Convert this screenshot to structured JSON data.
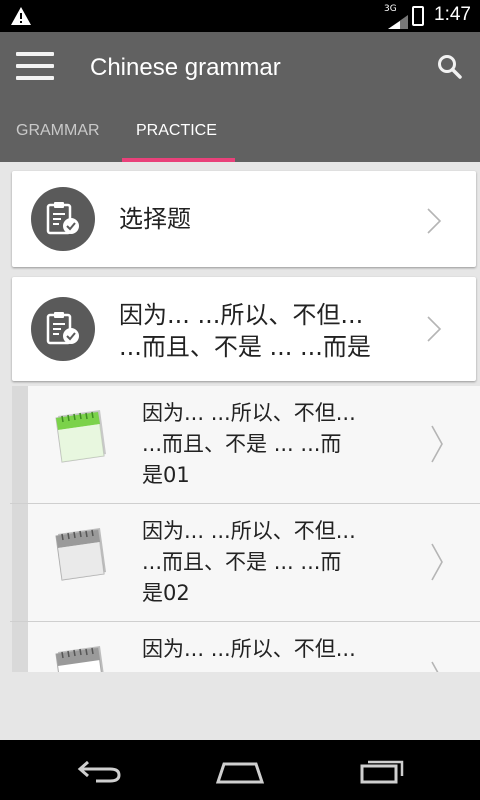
{
  "status_bar": {
    "network": "3G",
    "time": "1:47"
  },
  "app_bar": {
    "title": "Chinese grammar"
  },
  "tabs": [
    {
      "label": "GRAMMAR",
      "selected": false
    },
    {
      "label": "PRACTICE",
      "selected": true
    }
  ],
  "colors": {
    "app_bar": "#616161",
    "tab_indicator": "#e9417a",
    "status_bar": "#000000"
  },
  "cards": [
    {
      "label": "选择题",
      "icon": "clipboard-check-icon"
    },
    {
      "label_line1": "因为... ...所以、不但...",
      "label_line2": "...而且、不是 ... ...而是",
      "icon": "clipboard-check-icon"
    }
  ],
  "sub_items": [
    {
      "line1": "因为... ...所以、不但...",
      "line2": "...而且、不是 ... ...而",
      "line3": "是01",
      "icon": "notepad-green-icon"
    },
    {
      "line1": "因为... ...所以、不但...",
      "line2": "...而且、不是 ... ...而",
      "line3": "是02",
      "icon": "notepad-gray-icon"
    },
    {
      "line1": "因为... ...所以、不但...",
      "icon": "notepad-gray-icon"
    }
  ]
}
